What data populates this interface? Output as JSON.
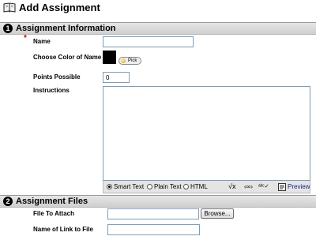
{
  "page": {
    "title": "Add Assignment"
  },
  "sections": [
    {
      "number": "1",
      "label": "Assignment Information"
    },
    {
      "number": "2",
      "label": "Assignment Files"
    }
  ],
  "form": {
    "required_marker": "*",
    "name_label": "Name",
    "name_value": "",
    "color_label": "Choose Color of Name",
    "color_value": "#000000",
    "pick_label": "Pick",
    "points_label": "Points Possible",
    "points_value": "0",
    "instructions_label": "Instructions",
    "instructions_value": ""
  },
  "editor": {
    "modes": [
      {
        "label": "Smart Text",
        "selected": true
      },
      {
        "label": "Plain Text",
        "selected": false
      },
      {
        "label": "HTML",
        "selected": false
      }
    ],
    "tools": [
      "math-icon",
      "link-icon",
      "spellcheck-icon"
    ],
    "preview_label": "Preview"
  },
  "files": {
    "file_label": "File To Attach",
    "file_value": "",
    "browse_label": "Browse...",
    "link_name_label": "Name of Link to File",
    "link_name_value": ""
  }
}
